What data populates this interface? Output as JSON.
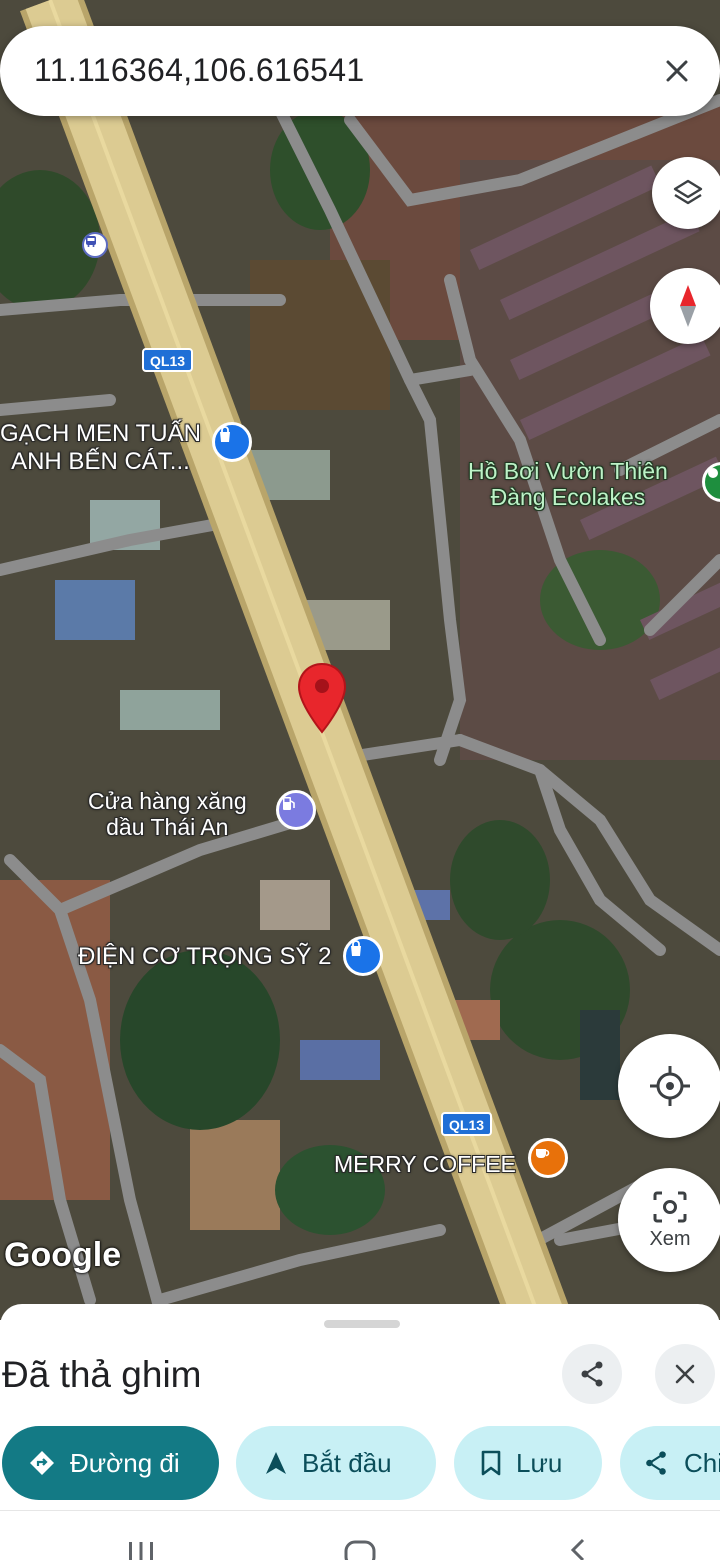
{
  "search": {
    "query": "11.116364,106.616541"
  },
  "map": {
    "labels": {
      "gach_men_line1": "GẠCH MEN TUẤN",
      "gach_men_line2": "ANH BẾN CÁT...",
      "ho_boi_line1": "Hồ Bơi Vườn Thiên",
      "ho_boi_line2": "Đàng Ecolakes",
      "cua_hang_line1": "Cửa hàng xăng",
      "cua_hang_line2": "dầu Thái An",
      "dien_co": "ĐIỆN CƠ TRỌNG SỸ 2",
      "merry_coffee": "MERRY COFFEE"
    },
    "road_shields": [
      "QL13",
      "QL13"
    ],
    "attribution": "Google"
  },
  "controls": {
    "lens_label": "Xem"
  },
  "sheet": {
    "title": "Đã thả ghim",
    "chips": [
      "Đường đi",
      "Bắt đầu",
      "Lưu",
      "Chia sẻ"
    ]
  },
  "colors": {
    "primary_chip": "#137a85",
    "chip": "#c8f0f5",
    "pin": "#e8262c",
    "road_main": "#d9c690",
    "road_minor": "#8c8c8c"
  },
  "icons": [
    "close-icon",
    "layers-icon",
    "compass-icon",
    "my-location-icon",
    "lens-icon",
    "share-icon",
    "directions-icon",
    "navigate-arrow-icon",
    "bookmark-icon",
    "pin-icon",
    "shopping-bag-icon",
    "gas-station-icon",
    "coffee-icon",
    "bus-stop-icon",
    "recent-apps-icon",
    "home-icon",
    "back-icon"
  ]
}
